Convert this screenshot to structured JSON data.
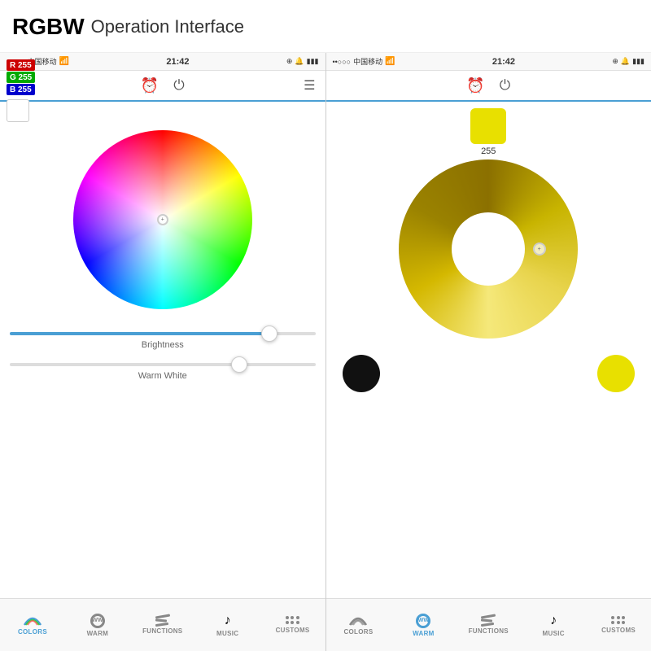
{
  "title": {
    "bold": "RGBW",
    "normal": "Operation Interface"
  },
  "left_phone": {
    "status": {
      "signal": "••○○○",
      "carrier": "中国移动",
      "wifi": "▲",
      "time": "21:42",
      "bluetooth": "✦",
      "battery": "▮▮▮▮"
    },
    "rgb": {
      "r_label": "R 255",
      "g_label": "G 255",
      "b_label": "B 255"
    },
    "brightness_label": "Brightness",
    "warmwhite_label": "Warm White",
    "nav": [
      {
        "id": "colors",
        "label": "COLORS",
        "active": true
      },
      {
        "id": "warm",
        "label": "WARM",
        "active": false
      },
      {
        "id": "functions",
        "label": "FUNCTIONS",
        "active": false
      },
      {
        "id": "music",
        "label": "MUSIC",
        "active": false
      },
      {
        "id": "customs",
        "label": "CUSTOMS",
        "active": false
      }
    ]
  },
  "right_phone": {
    "status": {
      "signal": "••○○○",
      "carrier": "中国移动",
      "wifi": "▲",
      "time": "21:42",
      "bluetooth": "✦",
      "battery": "▮▮▮▮"
    },
    "preview": {
      "color": "#e8e000",
      "value": "255"
    },
    "swatches": [
      {
        "color": "#111111",
        "label": "black"
      },
      {
        "color": "#e8e000",
        "label": "yellow"
      }
    ],
    "nav": [
      {
        "id": "colors",
        "label": "COLORS",
        "active": false
      },
      {
        "id": "warm",
        "label": "WARM",
        "active": true
      },
      {
        "id": "functions",
        "label": "FUNCTIONS",
        "active": false
      },
      {
        "id": "music",
        "label": "MUSIC",
        "active": false
      },
      {
        "id": "customs",
        "label": "CUSTOMS",
        "active": false
      }
    ]
  }
}
